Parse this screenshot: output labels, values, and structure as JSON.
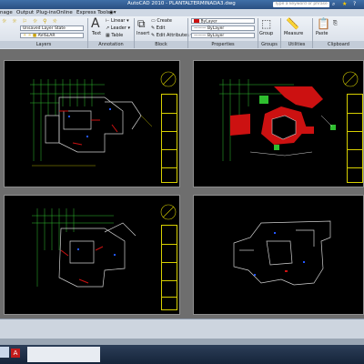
{
  "app": {
    "title": "AutoCAD 2010 - PLANTALTERMINADA3.dwg",
    "search_placeholder": "Type a keyword or phrase"
  },
  "tabs": [
    "nage",
    "Output",
    "Plug-ins",
    "Online",
    "Express Tools"
  ],
  "ribbon": {
    "layer_state": "Unsaved Layer State",
    "layer_current": "AVISLAR",
    "text_label": "Text",
    "linear_label": "Linear",
    "leader_label": "Leader",
    "table_label": "Table",
    "insert_label": "Insert",
    "create_label": "Create",
    "edit_label": "Edit",
    "edit_attributes_label": "Edit Attributes",
    "bylayer_color": "ByLayer",
    "bylayer_linetype": "ByLayer",
    "bylayer_lineweight": "ByLayer",
    "group_label": "Group",
    "measure_label": "Measure",
    "paste_label": "Paste",
    "panels": {
      "layers": "Layers",
      "annotation": "Annotation",
      "block": "Block",
      "properties": "Properties",
      "groups": "Groups",
      "utilities": "Utilities",
      "clipboard": "Clipboard"
    }
  },
  "colors": {
    "drawing_bg": "#000000",
    "plan_lines": "#d0d0d0",
    "grid_green": "#2fbf2f",
    "accent_red": "#cc1111",
    "titleblock_yellow": "#d8d000"
  }
}
